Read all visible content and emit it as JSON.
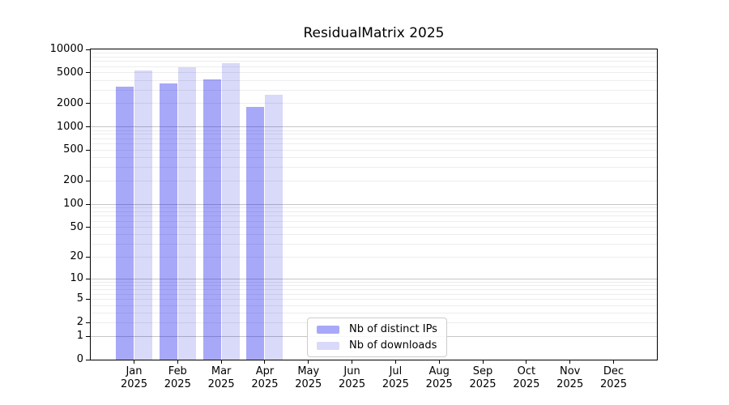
{
  "chart_data": {
    "type": "bar",
    "title": "ResidualMatrix 2025",
    "year_label": "2025",
    "categories": [
      "Jan",
      "Feb",
      "Mar",
      "Apr",
      "May",
      "Jun",
      "Jul",
      "Aug",
      "Sep",
      "Oct",
      "Nov",
      "Dec"
    ],
    "series": [
      {
        "name": "Nb of distinct IPs",
        "color": "rgba(6,6,235,0.35)",
        "values": [
          3300,
          3650,
          4100,
          1800,
          null,
          null,
          null,
          null,
          null,
          null,
          null,
          null
        ]
      },
      {
        "name": "Nb of downloads",
        "color": "rgba(2,2,222,0.15)",
        "values": [
          5400,
          5900,
          6700,
          2600,
          null,
          null,
          null,
          null,
          null,
          null,
          null,
          null
        ]
      }
    ],
    "y_ticks": [
      0,
      1,
      2,
      5,
      10,
      20,
      50,
      100,
      200,
      500,
      1000,
      2000,
      5000,
      10000
    ],
    "ylim": [
      0,
      10000
    ],
    "y_scale": "log10(value+1)",
    "xlabel": "",
    "ylabel": "",
    "grid": "horizontal minor lines at 2-9 per decade, darker lines at powers of 10",
    "legend_position": "inside plot, lower center",
    "colors": {
      "axis": "#000000",
      "grid_major": "#c6c6c6",
      "grid_minor": "#ededed",
      "legend_border": "#cccccc",
      "background": "#ffffff"
    }
  }
}
